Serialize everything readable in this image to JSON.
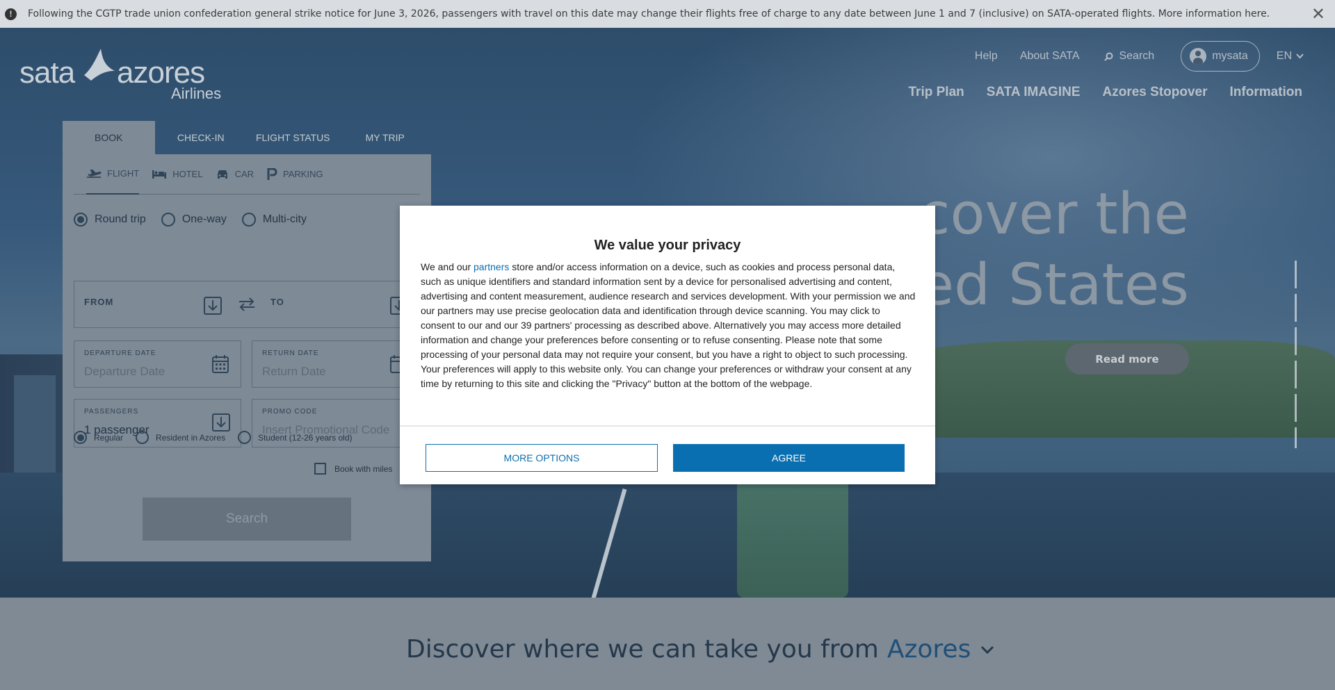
{
  "notice": {
    "text": "Following the CGTP trade union confederation general strike notice for June 3, 2026, passengers with travel on this date may change their flights free of charge to any date between June 1 and 7 (inclusive) on SATA-operated flights. More information here.",
    "info_icon": "info-icon",
    "close_icon": "close-icon"
  },
  "logo": {
    "sata": "sata",
    "azores": "azores",
    "airlines": "Airlines"
  },
  "topnav": {
    "help": "Help",
    "about": "About SATA",
    "search": "Search",
    "mysata": "mysata",
    "lang": "EN"
  },
  "mainnav": [
    "Trip Plan",
    "SATA IMAGINE",
    "Azores Stopover",
    "Information"
  ],
  "booking": {
    "tabs": [
      "BOOK",
      "CHECK-IN",
      "FLIGHT STATUS",
      "MY TRIP"
    ],
    "subtabs": [
      "FLIGHT",
      "HOTEL",
      "CAR",
      "PARKING"
    ],
    "trip_types": [
      "Round trip",
      "One-way",
      "Multi-city"
    ],
    "from_label": "FROM",
    "to_label": "TO",
    "departure_label": "DEPARTURE DATE",
    "departure_placeholder": "Departure Date",
    "return_label": "RETURN DATE",
    "return_placeholder": "Return Date",
    "passengers_label": "PASSENGERS",
    "passengers_value": "1 passenger",
    "promo_label": "PROMO CODE",
    "promo_placeholder": "Insert Promotional Code",
    "fare_types": [
      "Regular",
      "Resident in Azores",
      "Student (12-26 years old)"
    ],
    "miles": "Book with miles",
    "search": "Search"
  },
  "hero": {
    "headline_1": "cover the",
    "headline_2": "ed States",
    "read_more": "Read more"
  },
  "discover": {
    "prefix": "Discover where we can take you from",
    "place": "Azores"
  },
  "privacy": {
    "title": "We value your privacy",
    "text_before_link": "We and our ",
    "link": "partners",
    "text_after_link": " store and/or access information on a device, such as cookies and process personal data, such as unique identifiers and standard information sent by a device for personalised advertising and content, advertising and content measurement, audience research and services development. With your permission we and our partners may use precise geolocation data and identification through device scanning. You may click to consent to our and our 39 partners' processing as described above. Alternatively you may access more detailed information and change your preferences before consenting or to refuse consenting. Please note that some processing of your personal data may not require your consent, but you have a right to object to such processing. Your preferences will apply to this website only. You can change your preferences or withdraw your consent at any time by returning to this site and clicking the \"Privacy\" button at the bottom of the webpage.",
    "more_options": "MORE OPTIONS",
    "agree": "AGREE"
  }
}
